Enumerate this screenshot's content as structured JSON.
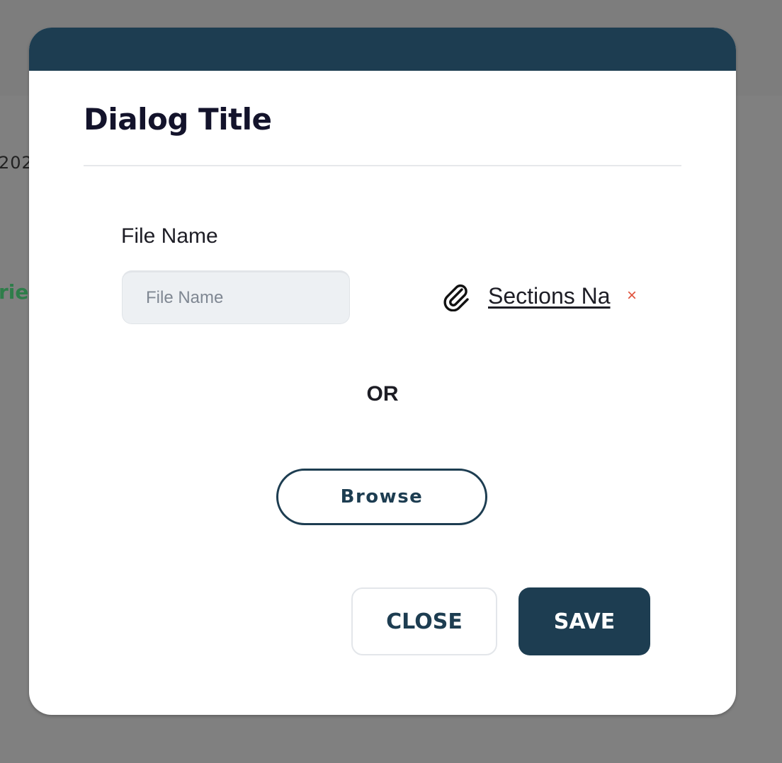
{
  "background": {
    "date_fragment": "202",
    "link_fragment": "ries"
  },
  "dialog": {
    "title": "Dialog Title",
    "field_label": "File Name",
    "file_input": {
      "value": "",
      "placeholder": "File Name"
    },
    "attachment": {
      "icon": "paperclip-icon",
      "name": "Sections Na",
      "remove_icon": "close-icon",
      "remove_symbol": "×"
    },
    "or_separator": "OR",
    "browse_label": "Browse",
    "close_label": "CLOSE",
    "save_label": "SAVE"
  },
  "colors": {
    "primary": "#1d3d51",
    "overlay": "#808080",
    "danger": "#e0533d",
    "input_bg": "#edf0f3",
    "background_link": "#2e7d4a"
  }
}
